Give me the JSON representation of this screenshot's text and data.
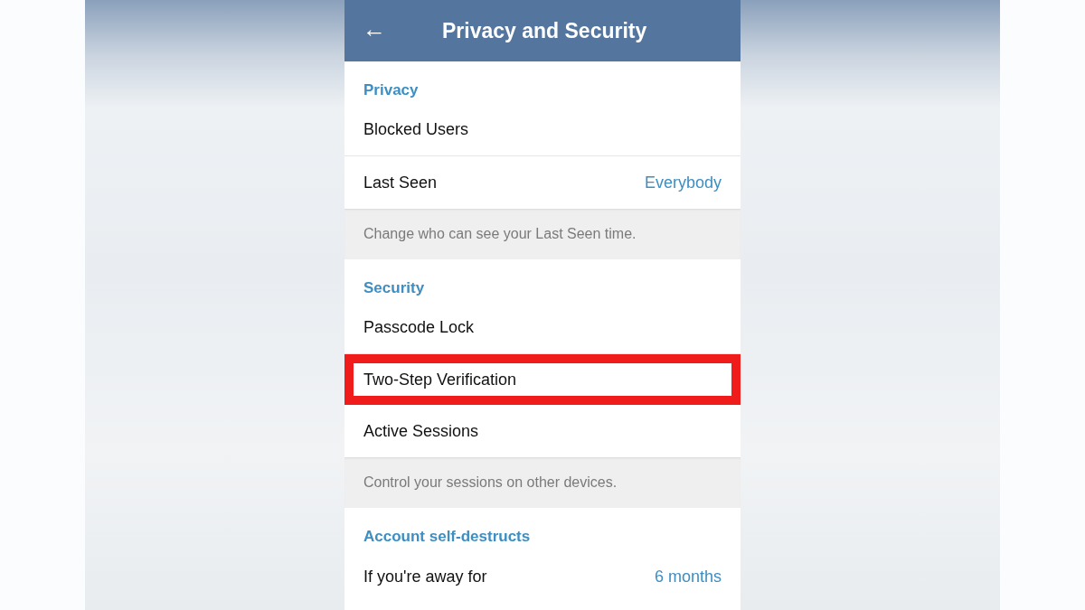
{
  "header": {
    "back_icon": "←",
    "title": "Privacy and Security"
  },
  "items": [
    {
      "kind": "section",
      "text": "Privacy"
    },
    {
      "kind": "row",
      "label": "Blocked Users",
      "highlighted": false
    },
    {
      "kind": "row",
      "label": "Last Seen",
      "value": "Everybody",
      "highlighted": false
    },
    {
      "kind": "hint",
      "text": "Change who can see your Last Seen time."
    },
    {
      "kind": "section",
      "text": "Security"
    },
    {
      "kind": "row",
      "label": "Passcode Lock",
      "highlighted": false
    },
    {
      "kind": "row",
      "label": "Two-Step Verification",
      "highlighted": true
    },
    {
      "kind": "row",
      "label": "Active Sessions",
      "highlighted": false
    },
    {
      "kind": "hint",
      "text": "Control your sessions on other devices."
    },
    {
      "kind": "section",
      "text": "Account self-destructs"
    },
    {
      "kind": "row",
      "label": "If you're away for",
      "value": "6 months",
      "highlighted": false
    }
  ]
}
